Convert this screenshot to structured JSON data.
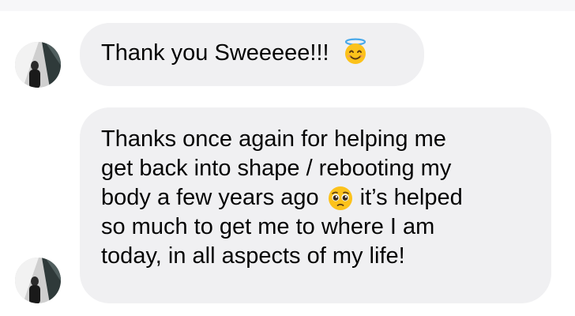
{
  "conversation": {
    "messages": [
      {
        "avatar_icon": "user-avatar-icon",
        "lines": [
          "Thank you Sweeeee!!!"
        ],
        "emoji": "smiling-face-with-halo-icon"
      },
      {
        "avatar_icon": "user-avatar-icon",
        "lines": [
          "Thanks once again for helping me",
          "get back into shape / rebooting my",
          "body a few years ago",
          "it’s helped",
          "so much to get me to where I am",
          "today, in all aspects of my life!"
        ],
        "emoji": "pleading-face-icon"
      }
    ]
  },
  "colors": {
    "bubble_background": "#f0f0f2",
    "text": "#050505",
    "page_background": "#ffffff"
  }
}
